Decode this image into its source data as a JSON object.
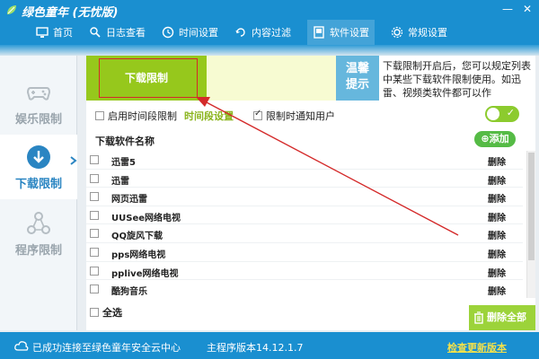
{
  "app": {
    "title": "绿色童年 (无忧版)"
  },
  "window": {
    "minimize": "—",
    "close": "✕"
  },
  "nav": [
    {
      "label": "首页",
      "icon": "monitor-icon"
    },
    {
      "label": "日志查看",
      "icon": "log-search-icon"
    },
    {
      "label": "时间设置",
      "icon": "clock-icon"
    },
    {
      "label": "内容过滤",
      "icon": "filter-icon"
    },
    {
      "label": "软件设置",
      "icon": "software-icon",
      "active": true
    },
    {
      "label": "常规设置",
      "icon": "gear-icon"
    }
  ],
  "sidebar": [
    {
      "label": "娱乐限制",
      "icon": "gamepad-icon"
    },
    {
      "label": "下载限制",
      "icon": "download-icon",
      "active": true
    },
    {
      "label": "程序限制",
      "icon": "program-share-icon"
    }
  ],
  "panel": {
    "tab_label": "下载限制",
    "tip_badge": [
      "温馨",
      "提示"
    ],
    "tip_text": "下载限制开启后，您可以规定列表中某些下载软件限制使用。如迅雷、视频类软件都可以作",
    "opt_time_label": "启用时间段限制",
    "opt_time_link": "时间段设置",
    "opt_notify_label": "限制时通知用户",
    "opt_time_checked": false,
    "opt_notify_checked": true,
    "toggle_on": true,
    "list_header": "下载软件名称",
    "add_label": "添加",
    "select_all": "全选",
    "delete_all": "删除全部"
  },
  "items": [
    {
      "name": "迅雷5",
      "action": "删除"
    },
    {
      "name": "迅雷",
      "action": "删除"
    },
    {
      "name": "网页迅雷",
      "action": "删除"
    },
    {
      "name": "UUSee网络电视",
      "action": "删除"
    },
    {
      "name": "QQ旋风下载",
      "action": "删除"
    },
    {
      "name": "pps网络电视",
      "action": "删除"
    },
    {
      "name": "pplive网络电视",
      "action": "删除"
    },
    {
      "name": "酷狗音乐",
      "action": "删除"
    }
  ],
  "footer": {
    "status": "已成功连接至绿色童年安全云中心",
    "version": "主程序版本14.12.1.7",
    "update": "检查更新版本"
  },
  "colors": {
    "brand_blue": "#1a8fd0",
    "accent_green": "#96c81c",
    "highlight_red": "#d42a2a"
  }
}
